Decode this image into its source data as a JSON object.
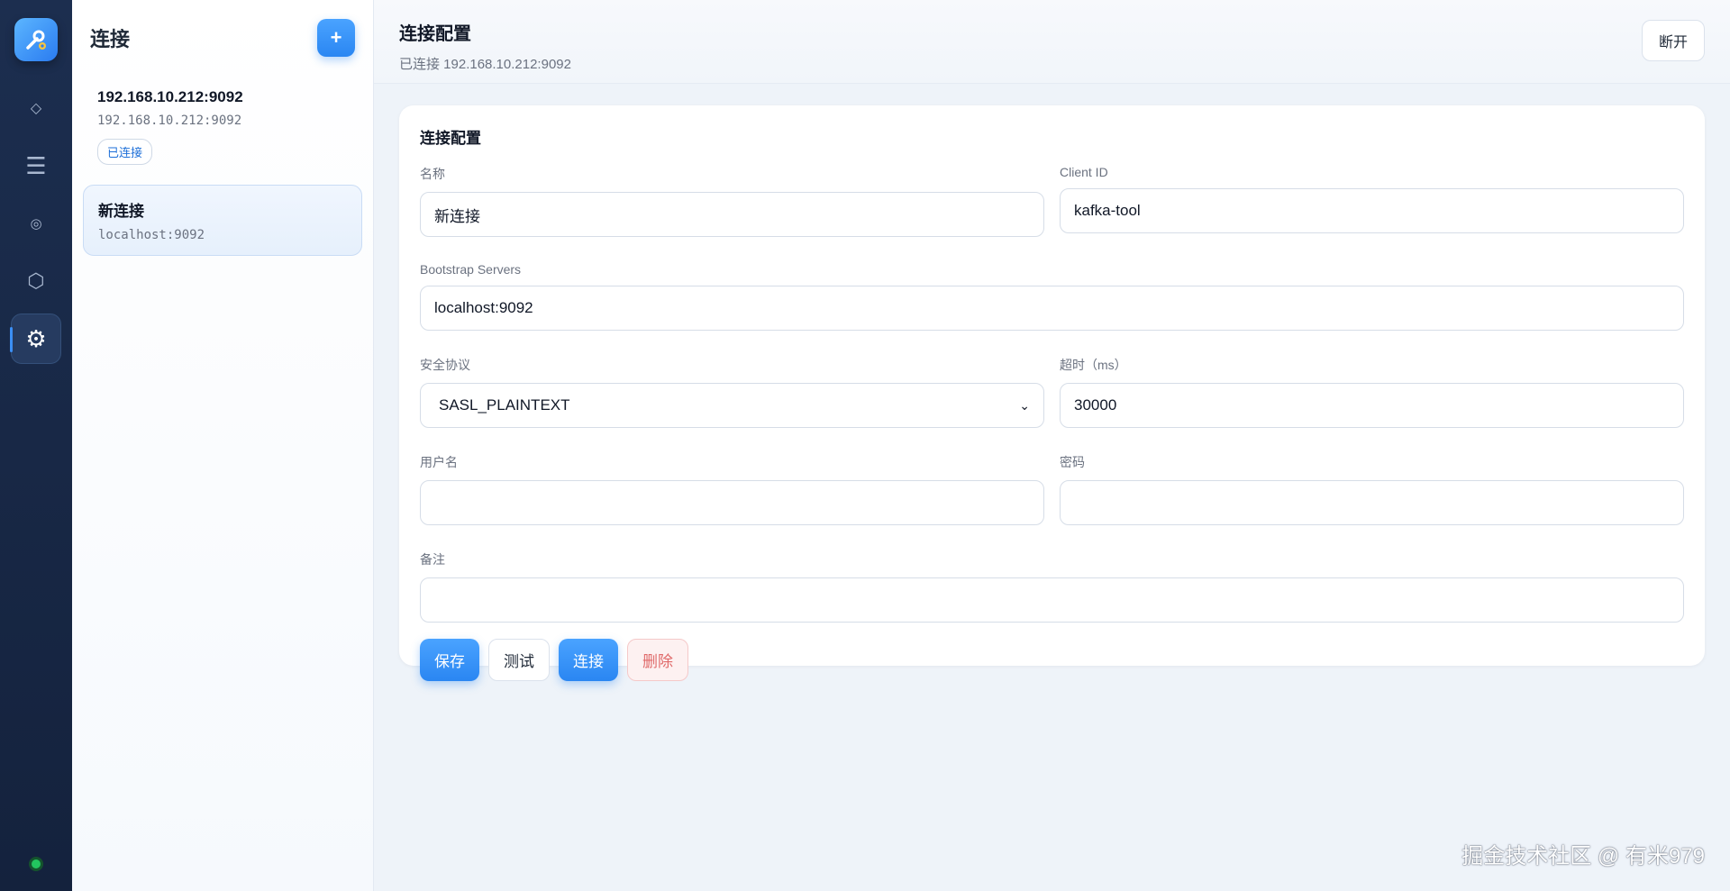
{
  "sidebar": {
    "nav": [
      {
        "icon": "diamond-icon",
        "glyph": "◇"
      },
      {
        "icon": "menu-icon",
        "glyph": "☰"
      },
      {
        "icon": "target-icon",
        "glyph": "◎"
      },
      {
        "icon": "hexagon-icon",
        "glyph": "⬡"
      },
      {
        "icon": "gear-icon",
        "glyph": "⚙",
        "active": true
      }
    ],
    "status_color": "#22c55e"
  },
  "connections": {
    "title": "连接",
    "add_label": "+",
    "items": [
      {
        "name": "192.168.10.212:9092",
        "address": "192.168.10.212:9092",
        "badge": "已连接"
      },
      {
        "name": "新连接",
        "address": "localhost:9092",
        "selected": true
      }
    ]
  },
  "header": {
    "title": "连接配置",
    "subtitle": "已连接 192.168.10.212:9092",
    "disconnect_label": "断开"
  },
  "form": {
    "title": "连接配置",
    "name_label": "名称",
    "name_value": "新连接",
    "client_id_label": "Client ID",
    "client_id_value": "kafka-tool",
    "bootstrap_label": "Bootstrap Servers",
    "bootstrap_value": "localhost:9092",
    "protocol_label": "安全协议",
    "protocol_value": "SASL_PLAINTEXT",
    "timeout_label": "超时（ms）",
    "timeout_value": "30000",
    "username_label": "用户名",
    "username_value": "",
    "password_label": "密码",
    "password_value": "",
    "notes_label": "备注",
    "notes_value": ""
  },
  "actions": {
    "save": "保存",
    "test": "测试",
    "connect": "连接",
    "delete": "删除"
  },
  "watermark": "掘金技术社区 @ 有米979",
  "colors": {
    "accent": "#2a86f2",
    "rail_bg": "#1c2e4f",
    "danger": "#e06a6a"
  }
}
